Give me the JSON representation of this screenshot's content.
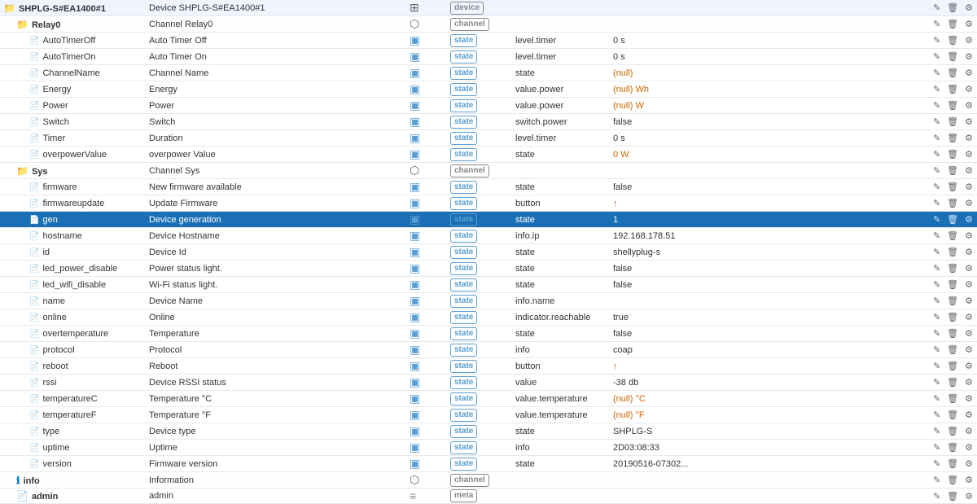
{
  "rows": [
    {
      "type": "folder",
      "indent": 0,
      "name": "SHPLG-S#EA1400#1",
      "description": "Device SHPLG-S#EA1400#1",
      "icon": "folder",
      "badge": "device",
      "badge_type": "device",
      "col5": "",
      "value": "",
      "selected": false
    },
    {
      "type": "folder",
      "indent": 1,
      "name": "Relay0",
      "description": "Channel Relay0",
      "icon": "folder",
      "badge": "channel",
      "badge_type": "channel",
      "col5": "",
      "value": "",
      "selected": false
    },
    {
      "type": "file",
      "indent": 2,
      "name": "AutoTimerOff",
      "description": "Auto Timer Off",
      "icon": "file",
      "badge": "state",
      "badge_type": "state",
      "col5": "level.timer",
      "value": "0 s",
      "selected": false
    },
    {
      "type": "file",
      "indent": 2,
      "name": "AutoTimerOn",
      "description": "Auto Timer On",
      "icon": "file",
      "badge": "state",
      "badge_type": "state",
      "col5": "level.timer",
      "value": "0 s",
      "selected": false
    },
    {
      "type": "file",
      "indent": 2,
      "name": "ChannelName",
      "description": "Channel Name",
      "icon": "file",
      "badge": "state",
      "badge_type": "state",
      "col5": "state",
      "value": "(null)",
      "value_class": "orange",
      "selected": false
    },
    {
      "type": "file",
      "indent": 2,
      "name": "Energy",
      "description": "Energy",
      "icon": "file",
      "badge": "state",
      "badge_type": "state",
      "col5": "value.power",
      "value": "(null) Wh",
      "value_class": "orange",
      "selected": false
    },
    {
      "type": "file",
      "indent": 2,
      "name": "Power",
      "description": "Power",
      "icon": "file",
      "badge": "state",
      "badge_type": "state",
      "col5": "value.power",
      "value": "(null) W",
      "value_class": "orange",
      "selected": false
    },
    {
      "type": "file",
      "indent": 2,
      "name": "Switch",
      "description": "Switch",
      "icon": "file",
      "badge": "state",
      "badge_type": "state",
      "col5": "switch.power",
      "value": "false",
      "selected": false
    },
    {
      "type": "file",
      "indent": 2,
      "name": "Timer",
      "description": "Duration",
      "icon": "file",
      "badge": "state",
      "badge_type": "state",
      "col5": "level.timer",
      "value": "0 s",
      "selected": false
    },
    {
      "type": "file",
      "indent": 2,
      "name": "overpowerValue",
      "description": "overpower Value",
      "icon": "file",
      "badge": "state",
      "badge_type": "state",
      "col5": "state",
      "value": "0 W",
      "value_class": "orange",
      "selected": false
    },
    {
      "type": "folder",
      "indent": 1,
      "name": "Sys",
      "description": "Channel Sys",
      "icon": "folder",
      "badge": "channel",
      "badge_type": "channel",
      "col5": "",
      "value": "",
      "selected": false
    },
    {
      "type": "file",
      "indent": 2,
      "name": "firmware",
      "description": "New firmware available",
      "icon": "file",
      "badge": "state",
      "badge_type": "state",
      "col5": "state",
      "value": "false",
      "selected": false
    },
    {
      "type": "file",
      "indent": 2,
      "name": "firmwareupdate",
      "description": "Update Firmware",
      "icon": "file",
      "badge": "state",
      "badge_type": "state",
      "col5": "button",
      "value": "↑",
      "value_class": "orange",
      "selected": false
    },
    {
      "type": "file",
      "indent": 2,
      "name": "gen",
      "description": "Device generation",
      "icon": "file",
      "badge": "state",
      "badge_type": "state",
      "col5": "state",
      "value": "1",
      "selected": true
    },
    {
      "type": "file",
      "indent": 2,
      "name": "hostname",
      "description": "Device Hostname",
      "icon": "file",
      "badge": "state",
      "badge_type": "state",
      "col5": "info.ip",
      "value": "192.168.178.51",
      "selected": false
    },
    {
      "type": "file",
      "indent": 2,
      "name": "id",
      "description": "Device Id",
      "icon": "file",
      "badge": "state",
      "badge_type": "state",
      "col5": "state",
      "value": "shellyplug-s",
      "selected": false
    },
    {
      "type": "file",
      "indent": 2,
      "name": "led_power_disable",
      "description": "Power status light.",
      "icon": "file",
      "badge": "state",
      "badge_type": "state",
      "col5": "state",
      "value": "false",
      "selected": false
    },
    {
      "type": "file",
      "indent": 2,
      "name": "led_wifi_disable",
      "description": "Wi-Fi status light.",
      "icon": "file",
      "badge": "state",
      "badge_type": "state",
      "col5": "state",
      "value": "false",
      "selected": false
    },
    {
      "type": "file",
      "indent": 2,
      "name": "name",
      "description": "Device Name",
      "icon": "file",
      "badge": "state",
      "badge_type": "state",
      "col5": "info.name",
      "value": "",
      "selected": false
    },
    {
      "type": "file",
      "indent": 2,
      "name": "online",
      "description": "Online",
      "icon": "file",
      "badge": "state",
      "badge_type": "state",
      "col5": "indicator.reachable",
      "value": "true",
      "selected": false
    },
    {
      "type": "file",
      "indent": 2,
      "name": "overtemperature",
      "description": "Temperature",
      "icon": "file",
      "badge": "state",
      "badge_type": "state",
      "col5": "state",
      "value": "false",
      "selected": false
    },
    {
      "type": "file",
      "indent": 2,
      "name": "protocol",
      "description": "Protocol",
      "icon": "file",
      "badge": "state",
      "badge_type": "state",
      "col5": "info",
      "value": "coap",
      "selected": false
    },
    {
      "type": "file",
      "indent": 2,
      "name": "reboot",
      "description": "Reboot",
      "icon": "file",
      "badge": "state",
      "badge_type": "state",
      "col5": "button",
      "value": "↑",
      "value_class": "orange",
      "selected": false
    },
    {
      "type": "file",
      "indent": 2,
      "name": "rssi",
      "description": "Device RSSI status",
      "icon": "file",
      "badge": "state",
      "badge_type": "state",
      "col5": "value",
      "value": "-38 db",
      "selected": false
    },
    {
      "type": "file",
      "indent": 2,
      "name": "temperatureC",
      "description": "Temperature °C",
      "icon": "file",
      "badge": "state",
      "badge_type": "state",
      "col5": "value.temperature",
      "value": "(null) °C",
      "value_class": "orange",
      "selected": false
    },
    {
      "type": "file",
      "indent": 2,
      "name": "temperatureF",
      "description": "Temperature °F",
      "icon": "file",
      "badge": "state",
      "badge_type": "state",
      "col5": "value.temperature",
      "value": "(null) °F",
      "value_class": "orange",
      "selected": false
    },
    {
      "type": "file",
      "indent": 2,
      "name": "type",
      "description": "Device type",
      "icon": "file",
      "badge": "state",
      "badge_type": "state",
      "col5": "state",
      "value": "SHPLG-S",
      "selected": false
    },
    {
      "type": "file",
      "indent": 2,
      "name": "uptime",
      "description": "Uptime",
      "icon": "file",
      "badge": "state",
      "badge_type": "state",
      "col5": "info",
      "value": "2D03:08:33",
      "selected": false
    },
    {
      "type": "file",
      "indent": 2,
      "name": "version",
      "description": "Firmware version",
      "icon": "file",
      "badge": "state",
      "badge_type": "state",
      "col5": "state",
      "value": "20190516-07302...",
      "selected": false
    },
    {
      "type": "folder",
      "indent": 1,
      "name": "info",
      "description": "Information",
      "icon": "info",
      "badge": "channel",
      "badge_type": "channel",
      "col5": "",
      "value": "",
      "selected": false
    },
    {
      "type": "folder",
      "indent": 1,
      "name": "admin",
      "description": "admin",
      "icon": "admin",
      "badge": "meta",
      "badge_type": "meta",
      "col5": "",
      "value": "",
      "selected": false
    }
  ],
  "actions": {
    "edit": "✎",
    "delete": "🗑",
    "settings": "⚙"
  }
}
